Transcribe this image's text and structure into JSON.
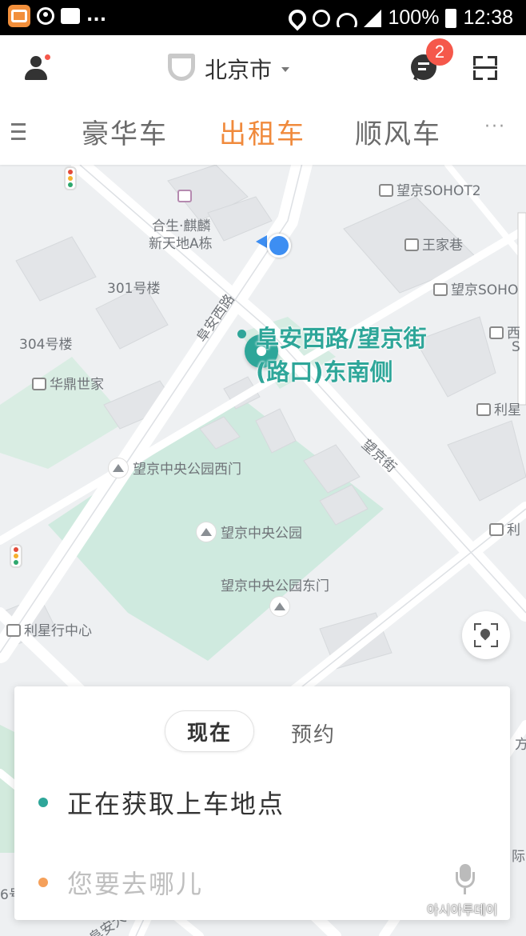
{
  "status_bar": {
    "battery": "100%",
    "time": "12:38",
    "overflow": "..."
  },
  "header": {
    "city": "北京市",
    "message_badge": "2",
    "icons": {
      "user": "user-icon",
      "city_logo": "didi-logo-icon",
      "message": "message-icon",
      "scan": "scan-icon"
    }
  },
  "tabs": [
    {
      "label": "豪华车",
      "active": false
    },
    {
      "label": "出租车",
      "active": true
    },
    {
      "label": "顺风车",
      "active": false
    }
  ],
  "tabs_more": "···",
  "map": {
    "pois": {
      "wangjing_soho2": "望京SOHOT2",
      "hesheng": "合生·麒麟",
      "hesheng2": "新天地A栋",
      "wangjiaxiang": "王家巷",
      "building301": "301号楼",
      "wangjing_soho": "望京SOHO",
      "building304": "304号楼",
      "huading": "华鼎世家",
      "lixing": "利星",
      "park_west": "望京中央公园西门",
      "park": "望京中央公园",
      "park_east": "望京中央公园东门",
      "lixing_center": "利星行中心",
      "edge_li": "利",
      "edge_xi": "西",
      "edge_s": "S",
      "edge_fang": "方",
      "edge_ji": "际",
      "edge_6": "6号"
    },
    "roads": {
      "fuan_west": "阜安西路",
      "wangjing_street": "望京街",
      "bottom_road": "阜安大"
    },
    "pickup_label_line1": "阜安西路/望京街",
    "pickup_label_line2": "(路口)东南侧"
  },
  "card": {
    "mode_now": "现在",
    "mode_reserve": "预约",
    "pickup_status": "正在获取上车地点",
    "destination_placeholder": "您要去哪儿"
  },
  "colors": {
    "accent_orange": "#f08a3c",
    "pickup_green": "#2ea699",
    "location_blue": "#3d8ef2",
    "badge_red": "#f5584b"
  },
  "watermark": "아시아투데이"
}
